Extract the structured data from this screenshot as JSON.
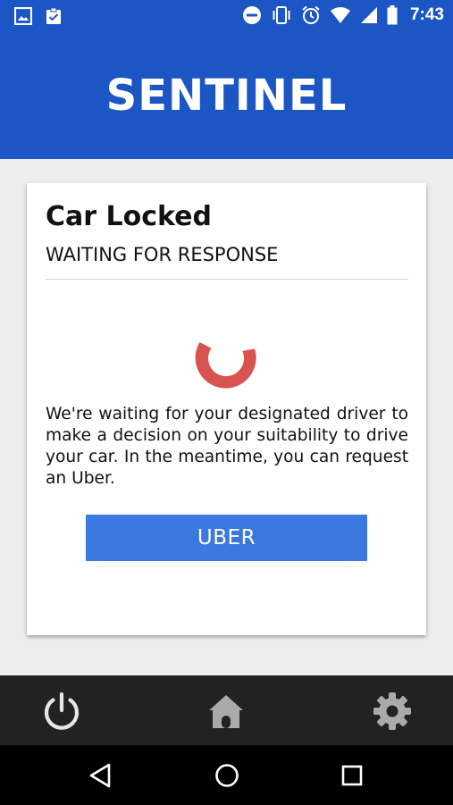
{
  "status_bar": {
    "time": "7:43",
    "icons": [
      "image-icon",
      "clipboard-check-icon",
      "do-not-disturb-icon",
      "vibrate-icon",
      "alarm-icon",
      "wifi-icon",
      "signal-icon",
      "battery-icon"
    ]
  },
  "app_bar": {
    "title": "SENTINEL"
  },
  "card": {
    "title": "Car Locked",
    "subtitle": "WAITING FOR RESPONSE",
    "spinner_color": "#d9534f",
    "message": "We're waiting for your designated driver to make a decision on your suitability to drive your car. In the meantime, you can request an Uber.",
    "button_label": "UBER",
    "button_color": "#3b78e0"
  },
  "bottom_nav": {
    "items": [
      "power-icon",
      "home-icon",
      "settings-gear-icon"
    ]
  },
  "system_nav": {
    "items": [
      "back-triangle-icon",
      "home-circle-icon",
      "recents-square-icon"
    ]
  },
  "colors": {
    "primary": "#1c56c4",
    "background": "#ededed",
    "bottom_nav": "#222222",
    "nav_icon": "#d7d7d7"
  }
}
